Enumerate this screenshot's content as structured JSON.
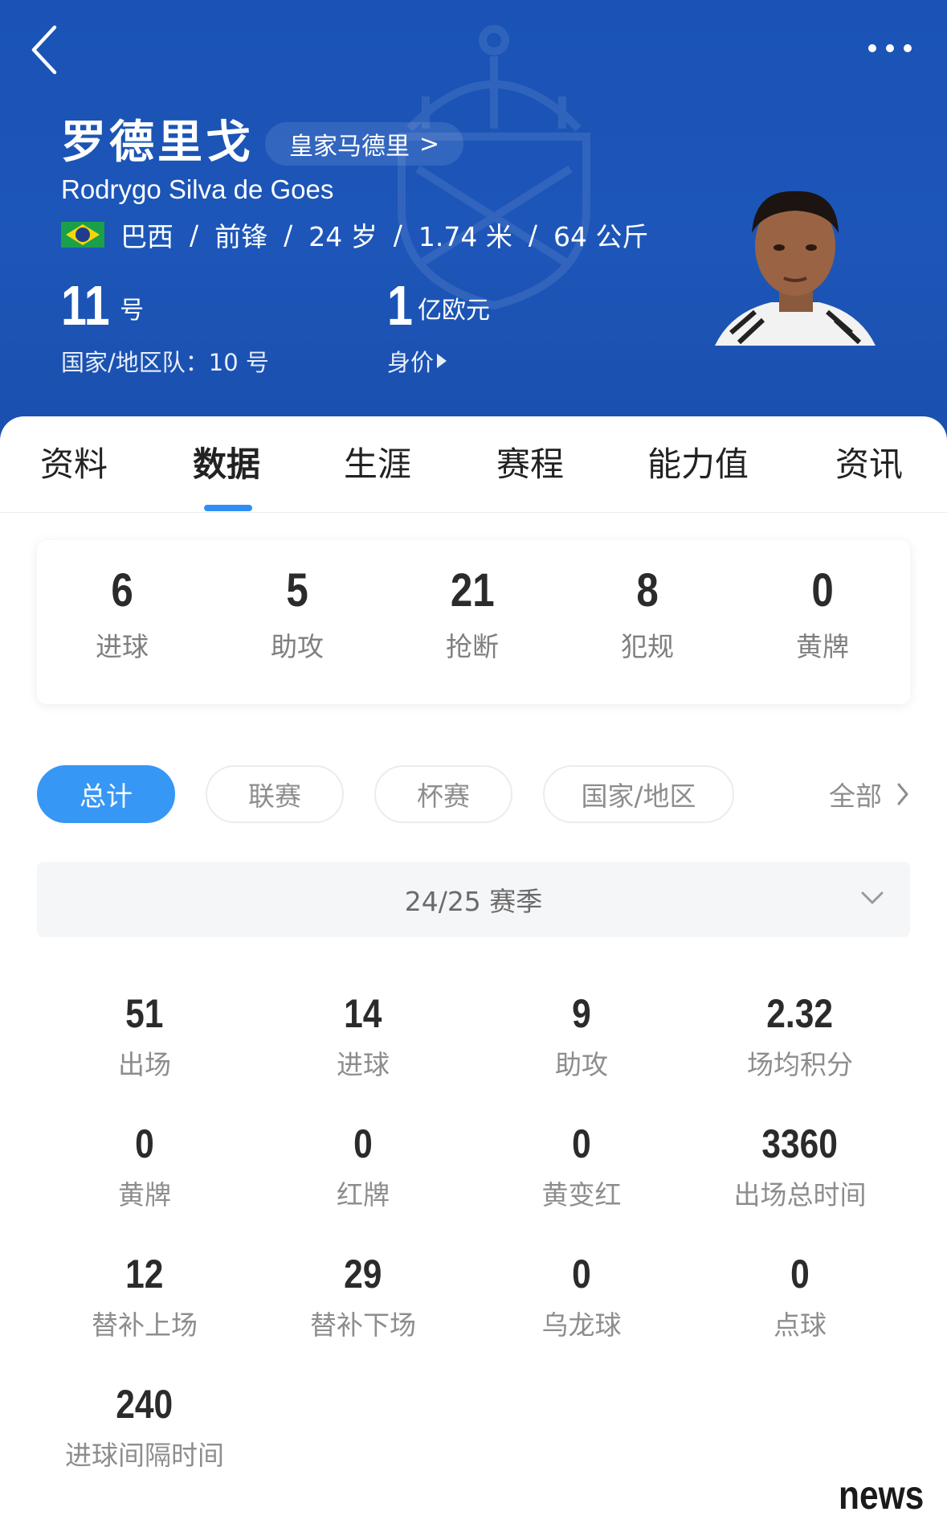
{
  "header": {
    "player_name_cn": "罗德里戈",
    "club_label": "皇家马德里",
    "club_chevron": ">",
    "player_name_en": "Rodrygo Silva de Goes",
    "flag_icon": "brazil-flag",
    "nationality": "巴西",
    "position": "前锋",
    "age": "24 岁",
    "height": "1.74 米",
    "weight": "64 公斤",
    "separator": "/",
    "shirt_number": "11",
    "shirt_unit": "号",
    "national_team_label": "国家/地区队：10 号",
    "value_number": "1",
    "value_unit": "亿欧元",
    "value_label": "身价",
    "colors": {
      "bg": "#1c55b7"
    }
  },
  "tabs": [
    {
      "label": "资料",
      "active": false
    },
    {
      "label": "数据",
      "active": true
    },
    {
      "label": "生涯",
      "active": false
    },
    {
      "label": "赛程",
      "active": false
    },
    {
      "label": "能力值",
      "active": false
    },
    {
      "label": "资讯",
      "active": false
    }
  ],
  "summary": [
    {
      "value": "6",
      "label": "进球"
    },
    {
      "value": "5",
      "label": "助攻"
    },
    {
      "value": "21",
      "label": "抢断"
    },
    {
      "value": "8",
      "label": "犯规"
    },
    {
      "value": "0",
      "label": "黄牌"
    }
  ],
  "filters": [
    {
      "label": "总计",
      "active": true
    },
    {
      "label": "联赛",
      "active": false
    },
    {
      "label": "杯赛",
      "active": false
    },
    {
      "label": "国家/地区",
      "active": false
    }
  ],
  "all_link": "全部",
  "season": "24/25 赛季",
  "stats": [
    {
      "value": "51",
      "label": "出场"
    },
    {
      "value": "14",
      "label": "进球"
    },
    {
      "value": "9",
      "label": "助攻"
    },
    {
      "value": "2.32",
      "label": "场均积分"
    },
    {
      "value": "0",
      "label": "黄牌"
    },
    {
      "value": "0",
      "label": "红牌"
    },
    {
      "value": "0",
      "label": "黄变红"
    },
    {
      "value": "3360",
      "label": "出场总时间"
    },
    {
      "value": "12",
      "label": "替补上场"
    },
    {
      "value": "29",
      "label": "替补下场"
    },
    {
      "value": "0",
      "label": "乌龙球"
    },
    {
      "value": "0",
      "label": "点球"
    },
    {
      "value": "240",
      "label": "进球间隔时间"
    }
  ],
  "watermark": "news",
  "accent_color": "#3797f5"
}
